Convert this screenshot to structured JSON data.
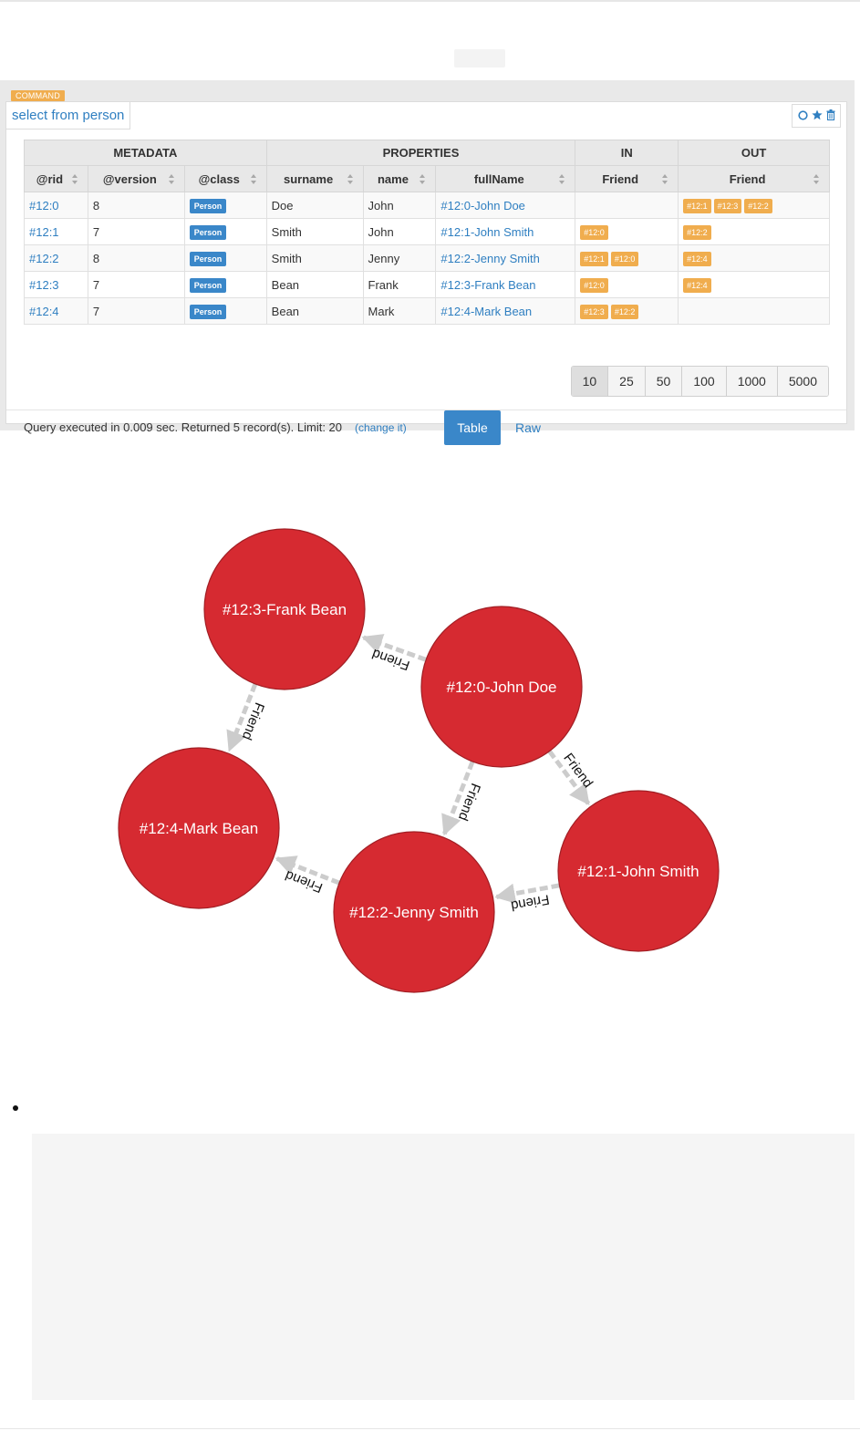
{
  "command": {
    "badge": "COMMAND",
    "query": "select from person",
    "icons": [
      "circle-icon",
      "star-icon",
      "trash-icon"
    ]
  },
  "table": {
    "groups": [
      "METADATA",
      "PROPERTIES",
      "IN",
      "OUT"
    ],
    "columns": [
      "@rid",
      "@version",
      "@class",
      "surname",
      "name",
      "fullName",
      "Friend",
      "Friend"
    ],
    "rows": [
      {
        "rid": "#12:0",
        "version": "8",
        "class": "Person",
        "surname": "Doe",
        "name": "John",
        "fullName": "#12:0-John Doe",
        "in": [],
        "out": [
          "#12:1",
          "#12:3",
          "#12:2"
        ]
      },
      {
        "rid": "#12:1",
        "version": "7",
        "class": "Person",
        "surname": "Smith",
        "name": "John",
        "fullName": "#12:1-John Smith",
        "in": [
          "#12:0"
        ],
        "out": [
          "#12:2"
        ]
      },
      {
        "rid": "#12:2",
        "version": "8",
        "class": "Person",
        "surname": "Smith",
        "name": "Jenny",
        "fullName": "#12:2-Jenny Smith",
        "in": [
          "#12:1",
          "#12:0"
        ],
        "out": [
          "#12:4"
        ]
      },
      {
        "rid": "#12:3",
        "version": "7",
        "class": "Person",
        "surname": "Bean",
        "name": "Frank",
        "fullName": "#12:3-Frank Bean",
        "in": [
          "#12:0"
        ],
        "out": [
          "#12:4"
        ]
      },
      {
        "rid": "#12:4",
        "version": "7",
        "class": "Person",
        "surname": "Bean",
        "name": "Mark",
        "fullName": "#12:4-Mark Bean",
        "in": [
          "#12:3",
          "#12:2"
        ],
        "out": []
      }
    ]
  },
  "pager": {
    "options": [
      "10",
      "25",
      "50",
      "100",
      "1000",
      "5000"
    ],
    "selected": "10"
  },
  "footer": {
    "status": "Query executed in 0.009 sec. Returned 5 record(s). Limit: 20",
    "change_link": "(change it)",
    "tab_table": "Table",
    "tab_raw": "Raw"
  },
  "graph": {
    "node_color": "#d62a31",
    "edge_color": "#cccccc",
    "nodes": [
      {
        "id": "#12:0",
        "label": "#12:0-John Doe"
      },
      {
        "id": "#12:1",
        "label": "#12:1-John Smith"
      },
      {
        "id": "#12:2",
        "label": "#12:2-Jenny Smith"
      },
      {
        "id": "#12:3",
        "label": "#12:3-Frank Bean"
      },
      {
        "id": "#12:4",
        "label": "#12:4-Mark Bean"
      }
    ],
    "edges": [
      {
        "from": "#12:0",
        "to": "#12:3",
        "label": "Friend"
      },
      {
        "from": "#12:0",
        "to": "#12:1",
        "label": "Friend"
      },
      {
        "from": "#12:0",
        "to": "#12:2",
        "label": "Friend"
      },
      {
        "from": "#12:1",
        "to": "#12:2",
        "label": "Friend"
      },
      {
        "from": "#12:2",
        "to": "#12:4",
        "label": "Friend"
      },
      {
        "from": "#12:3",
        "to": "#12:4",
        "label": "Friend"
      }
    ]
  },
  "colors": {
    "accent": "#3a87c9",
    "badge": "#f0ad4e",
    "link": "#2f7fc1"
  }
}
